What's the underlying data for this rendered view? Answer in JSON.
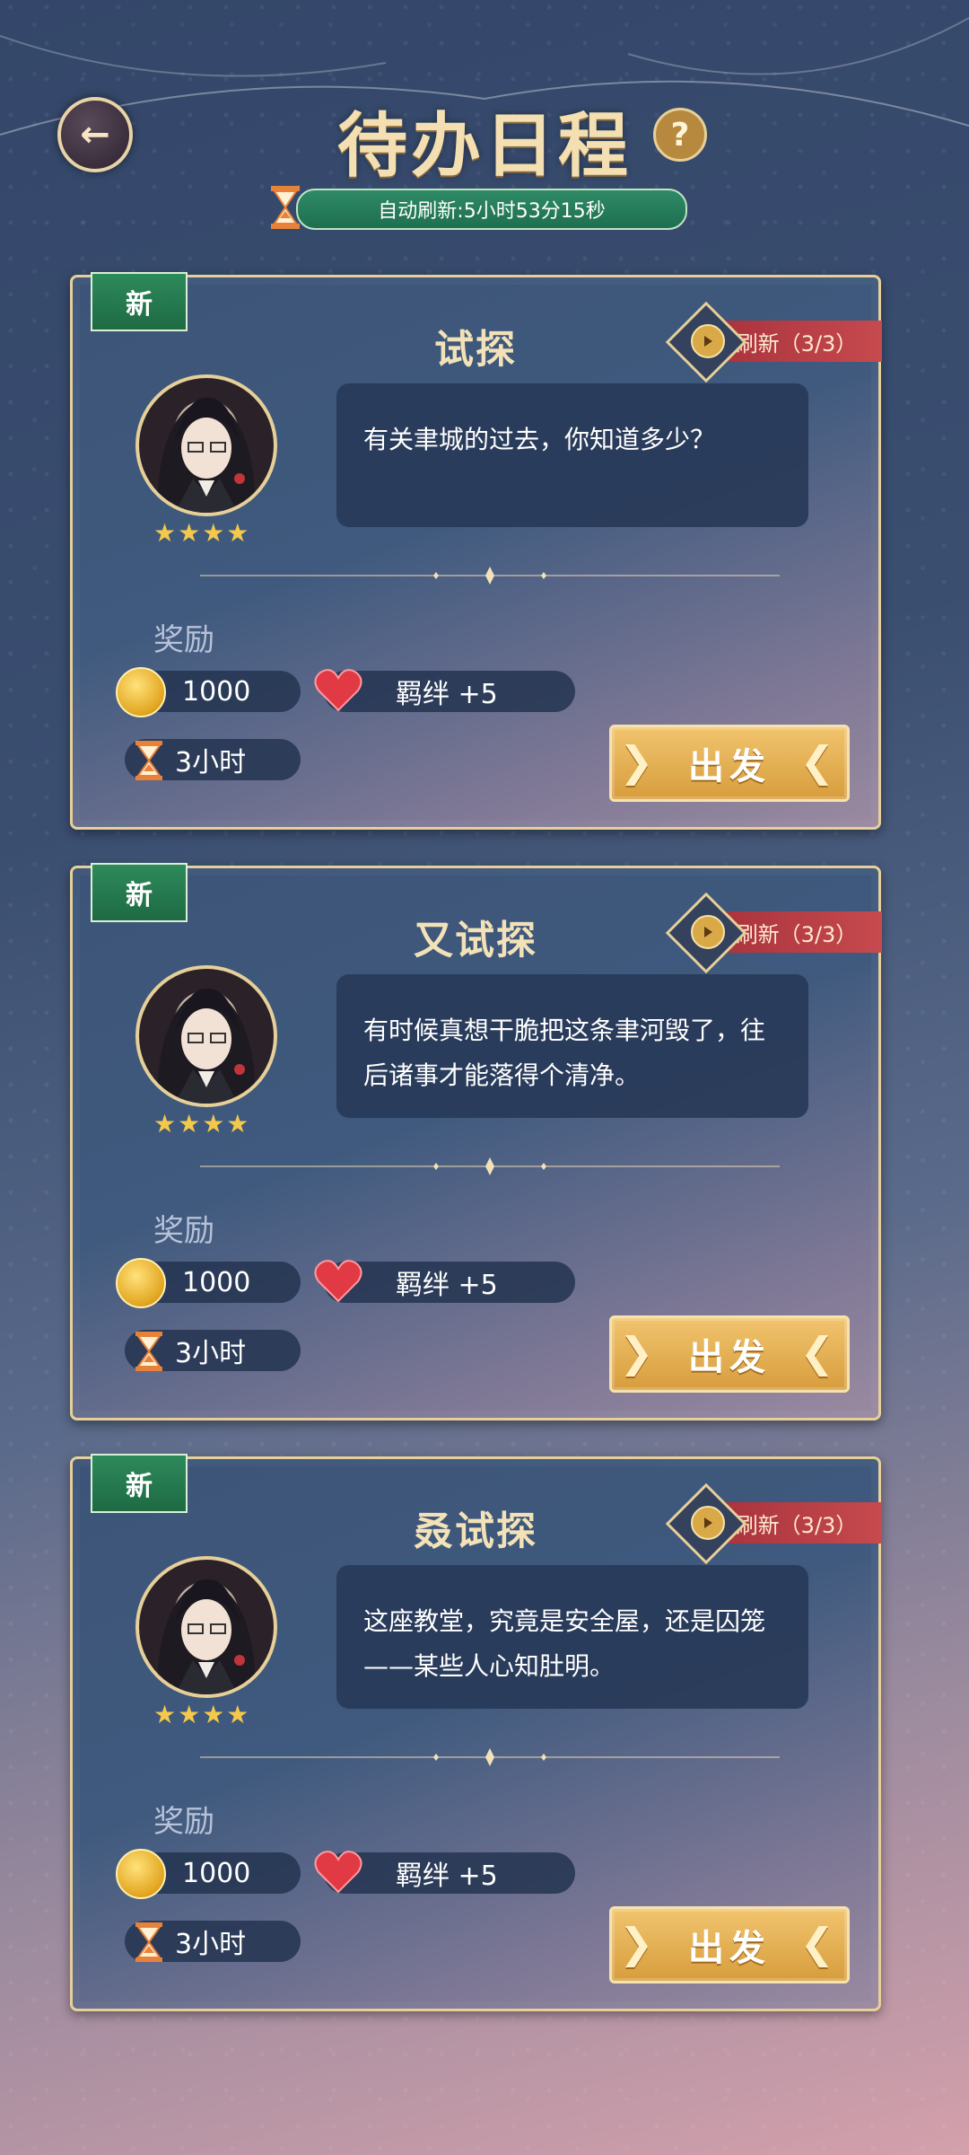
{
  "header": {
    "title": "待办日程",
    "help_symbol": "?",
    "auto_refresh_text": "自动刷新:5小时53分15秒"
  },
  "cards": [
    {
      "tag": "新",
      "title": "试探",
      "refresh_label": "刷新（3/3）",
      "rating": "★★★★",
      "dialogue": "有关聿城的过去，你知道多少？",
      "reward_label": "奖励",
      "coins": "1000",
      "bond": "羁绊 +5",
      "duration": "3小时",
      "go_label": "出发"
    },
    {
      "tag": "新",
      "title": "又试探",
      "refresh_label": "刷新（3/3）",
      "rating": "★★★★",
      "dialogue": "有时候真想干脆把这条聿河毁了，往后诸事才能落得个清净。",
      "reward_label": "奖励",
      "coins": "1000",
      "bond": "羁绊 +5",
      "duration": "3小时",
      "go_label": "出发"
    },
    {
      "tag": "新",
      "title": "叒试探",
      "refresh_label": "刷新（3/3）",
      "rating": "★★★★",
      "dialogue": "这座教堂，究竟是安全屋，还是囚笼——某些人心知肚明。",
      "reward_label": "奖励",
      "coins": "1000",
      "bond": "羁绊 +5",
      "duration": "3小时",
      "go_label": "出发"
    }
  ],
  "colors": {
    "gold_border": "#e6cf99",
    "go_button": "#e3ad52",
    "new_tag": "#2d8a5a",
    "refresh_tag": "#b53c44",
    "auto_refresh_bar": "#277c5b"
  },
  "icons": {
    "back": "back-arrow-icon",
    "help": "help-icon",
    "timer": "hourglass-icon",
    "coin": "coin-icon",
    "bond": "heart-icon",
    "refresh": "video-refresh-icon"
  }
}
